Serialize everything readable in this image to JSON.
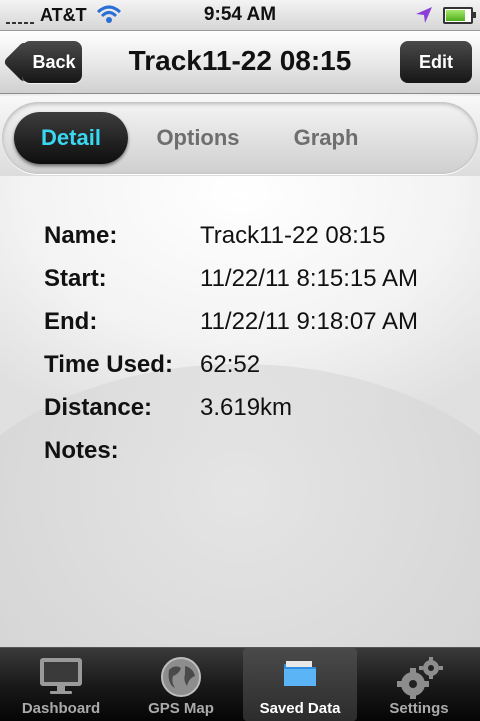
{
  "status_bar": {
    "carrier": "AT&T",
    "time": "9:54 AM",
    "battery_level": 0.85,
    "icons": [
      "signal-icon",
      "wifi-icon",
      "location-arrow-icon",
      "battery-icon"
    ]
  },
  "nav": {
    "back_label": "Back",
    "title": "Track11-22 08:15",
    "edit_label": "Edit"
  },
  "segments": {
    "items": [
      "Detail",
      "Options",
      "Graph"
    ],
    "selected": "Detail",
    "accent": "#39d8f2"
  },
  "details": [
    {
      "label": "Name:",
      "value": "Track11-22 08:15"
    },
    {
      "label": "Start:",
      "value": "11/22/11  8:15:15 AM"
    },
    {
      "label": "End:",
      "value": "11/22/11  9:18:07 AM"
    },
    {
      "label": "Time Used:",
      "value": "62:52"
    },
    {
      "label": "Distance:",
      "value": "3.619km"
    },
    {
      "label": "Notes:",
      "value": ""
    }
  ],
  "tabbar": {
    "items": [
      {
        "label": "Dashboard",
        "icon": "monitor-icon"
      },
      {
        "label": "GPS Map",
        "icon": "globe-icon"
      },
      {
        "label": "Saved Data",
        "icon": "folder-icon"
      },
      {
        "label": "Settings",
        "icon": "gears-icon"
      }
    ],
    "selected": "Saved Data"
  }
}
